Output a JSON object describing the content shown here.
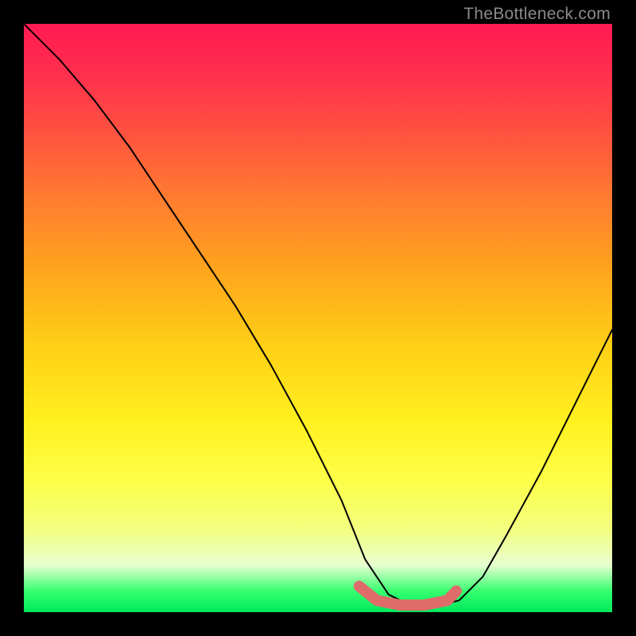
{
  "watermark": "TheBottleneck.com",
  "chart_data": {
    "type": "line",
    "title": "",
    "xlabel": "",
    "ylabel": "",
    "xlim": [
      0,
      100
    ],
    "ylim": [
      0,
      100
    ],
    "background_gradient": {
      "top": "#ff1a52",
      "mid": "#fff120",
      "bottom": "#00e85c"
    },
    "series": [
      {
        "name": "bottleneck-curve",
        "color": "#000000",
        "x": [
          0,
          6,
          12,
          18,
          24,
          30,
          36,
          42,
          48,
          54,
          58,
          62,
          66,
          70,
          74,
          78,
          82,
          88,
          94,
          100
        ],
        "y": [
          100,
          94,
          87,
          79,
          70,
          61,
          52,
          42,
          31,
          19,
          9,
          3,
          1,
          1,
          2,
          6,
          13,
          24,
          36,
          48
        ]
      },
      {
        "name": "optimal-band-marker",
        "color": "#e06868",
        "x": [
          57,
          60,
          64,
          68,
          72,
          73.5
        ],
        "y": [
          4.4,
          2.0,
          1.2,
          1.2,
          2.0,
          3.6
        ]
      }
    ]
  }
}
